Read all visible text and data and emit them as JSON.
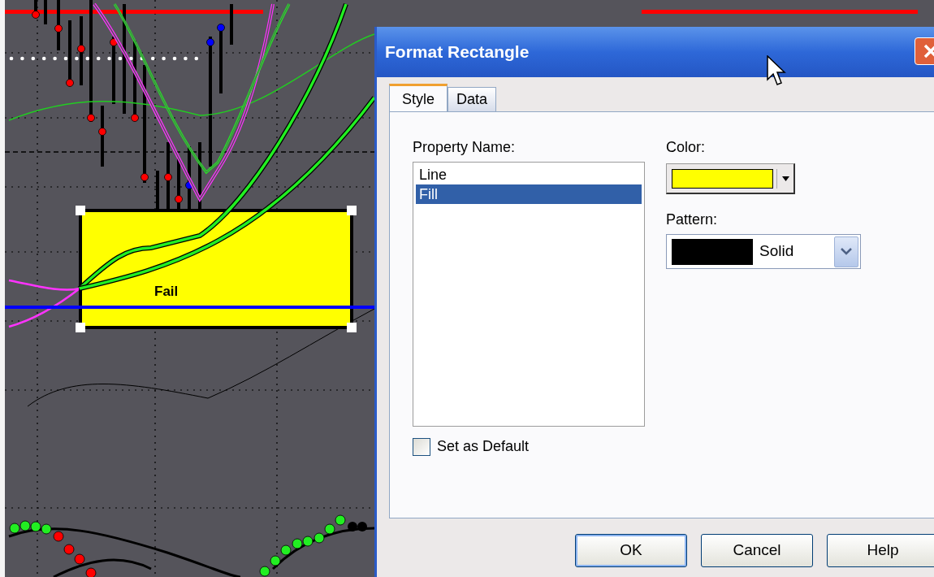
{
  "chart": {
    "annotation": {
      "label": "Fail"
    }
  },
  "dialog": {
    "title": "Format Rectangle",
    "tabs": [
      {
        "label": "Style",
        "selected": true
      },
      {
        "label": "Data",
        "selected": false
      }
    ],
    "property_list": {
      "heading": "Property Name:",
      "items": [
        {
          "label": "Line",
          "selected": false
        },
        {
          "label": "Fill",
          "selected": true
        }
      ]
    },
    "color": {
      "label": "Color:",
      "color": "#ffff00"
    },
    "pattern": {
      "label": "Pattern:",
      "value": "Solid"
    },
    "set_as_default": {
      "label": "Set as Default",
      "checked": false
    },
    "buttons": [
      "OK",
      "Cancel",
      "Help"
    ]
  }
}
